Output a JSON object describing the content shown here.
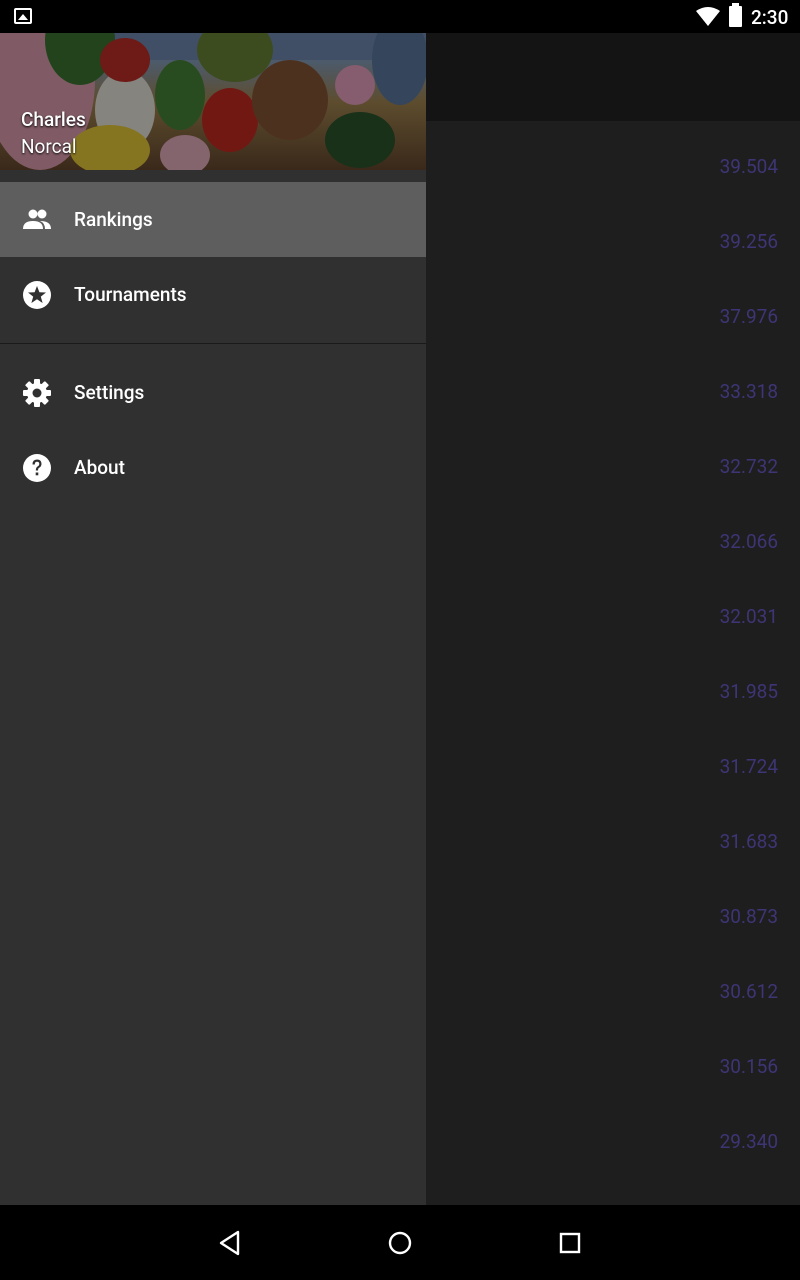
{
  "status_bar": {
    "time": "2:30",
    "icons": [
      "image-notification-icon",
      "wifi-icon",
      "battery-icon"
    ]
  },
  "drawer": {
    "header": {
      "user_name": "Charles",
      "region": "Norcal"
    },
    "items": [
      {
        "label": "Rankings",
        "icon": "people-icon",
        "selected": true
      },
      {
        "label": "Tournaments",
        "icon": "star-circle-icon",
        "selected": false
      },
      {
        "label": "Settings",
        "icon": "gear-icon",
        "selected": false
      },
      {
        "label": "About",
        "icon": "help-circle-icon",
        "selected": false
      }
    ]
  },
  "rankings": {
    "ratings": [
      "39.504",
      "39.256",
      "37.976",
      "33.318",
      "32.732",
      "32.066",
      "32.031",
      "31.985",
      "31.724",
      "31.683",
      "30.873",
      "30.612",
      "30.156",
      "29.340"
    ]
  },
  "nav_bar": {
    "buttons": [
      "back-icon",
      "home-icon",
      "recents-icon"
    ]
  },
  "colors": {
    "drawer_bg": "#303030",
    "selected_bg": "#5e5e5e",
    "rating_text": "#3d3575"
  }
}
